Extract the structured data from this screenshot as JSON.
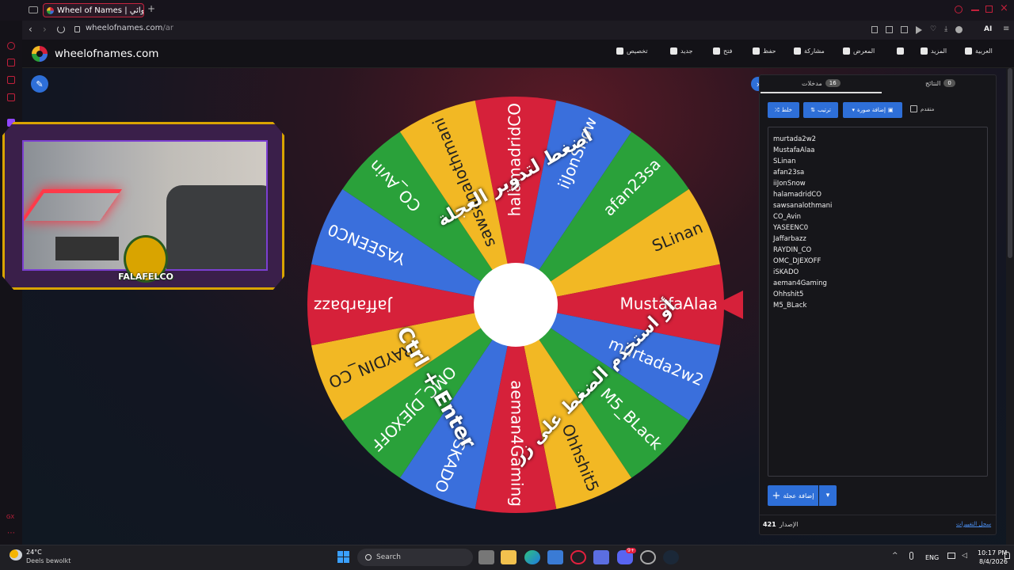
{
  "browser": {
    "tab_title": "Wheel of Names | العشوائي",
    "url_domain": "wheelofnames.com",
    "url_path": "/ar",
    "ai_label": "AI"
  },
  "sidebar": {
    "bottom_label": "GX"
  },
  "header": {
    "site_name": "wheelofnames.com",
    "menu": [
      {
        "label": "تخصيص",
        "icon": "palette-icon"
      },
      {
        "label": "جديد",
        "icon": "file-icon"
      },
      {
        "label": "فتح",
        "icon": "folder-icon"
      },
      {
        "label": "حفظ",
        "icon": "save-icon"
      },
      {
        "label": "مشاركة",
        "icon": "share-icon"
      },
      {
        "label": "المعرض",
        "icon": "search-icon"
      },
      {
        "label": "",
        "icon": "fullscreen-icon"
      },
      {
        "label": "المزيد",
        "icon": "chevron-down-icon"
      },
      {
        "label": "العربية",
        "icon": "globe-icon"
      }
    ]
  },
  "overlay": {
    "streamer_logo": "FALAFELCO"
  },
  "wheel": {
    "segments": [
      "halamadridCO",
      "iiJonSnow",
      "afan23sa",
      "SLinan",
      "MustafaAlaa",
      "murtada2w2",
      "M5_BLack",
      "Ohhshit5",
      "aeman4Gaming",
      "iSKADO",
      "OMC_DJEXOFF",
      "RAYDIN_CO",
      "Jaffarbazz",
      "YASEENC0",
      "CO_Avin",
      "sawsanalothmani"
    ],
    "segment_colors": [
      "#d6213a",
      "#3a6fdc",
      "#2aa13a",
      "#f2b824"
    ],
    "instruction_1": "اضغط لتدوير العجلة",
    "instruction_2": "أو استخدم الضغط على زر",
    "instruction_keys": "Ctrl + Enter"
  },
  "panel": {
    "tab_entries_label": "مدخلات",
    "tab_entries_count": "16",
    "tab_results_label": "النتائج",
    "tab_results_count": "0",
    "shuffle_label": "خلط",
    "sort_label": "ترتيب",
    "add_image_label": "إضافة صورة",
    "advanced_label": "متقدم",
    "entries": [
      "murtada2w2",
      "MustafaAlaa",
      "SLinan",
      "afan23sa",
      "iiJonSnow",
      "halamadridCO",
      "sawsanalothmani",
      "CO_Avin",
      "YASEENC0",
      "Jaffarbazz",
      "RAYDIN_CO",
      "OMC_DJEXOFF",
      "iSKADO",
      "aeman4Gaming",
      "Ohhshit5",
      "M5_BLack"
    ],
    "add_wheel_label": "إضافة عجلة",
    "version_label": "الإصدار",
    "version_number": "421",
    "changelog_link": "سجل التغييرات"
  },
  "taskbar": {
    "weather_temp": "24°C",
    "weather_desc": "Deels bewolkt",
    "search_placeholder": "Search",
    "lang": "ENG",
    "time": "10:17 PM",
    "date": "8/4/2026",
    "discord_badge": "9+"
  }
}
